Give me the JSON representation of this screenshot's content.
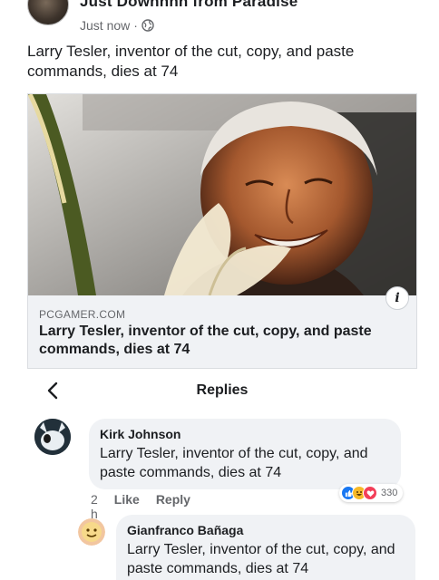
{
  "post": {
    "page_name": "Just Downnnn from Paradise",
    "time": "Just now",
    "separator": "·",
    "text": "Larry Tesler, inventor of the cut, copy, and paste commands, dies at 74"
  },
  "link_preview": {
    "domain": "PCGAMER.COM",
    "title": "Larry Tesler, inventor of the cut, copy, and paste commands, dies at 74",
    "info_glyph": "i"
  },
  "replies": {
    "title": "Replies",
    "back_icon": "chevron-left-icon"
  },
  "comments": [
    {
      "author": "Kirk Johnson",
      "text": "Larry Tesler, inventor of the cut, copy, and paste commands, dies at 74",
      "time": "2 h",
      "like_label": "Like",
      "reply_label": "Reply",
      "reaction_count": "330",
      "reactions": [
        "like",
        "haha",
        "love"
      ]
    },
    {
      "author": "Gianfranco Bañaga",
      "text": "Larry Tesler, inventor of the cut, copy, and paste commands, dies at 74"
    }
  ],
  "colors": {
    "bubble": "#f0f2f5",
    "meta_text": "#65676b",
    "like_blue": "#1877f2",
    "haha_yellow": "#f7b928",
    "love_red": "#f33e58"
  }
}
